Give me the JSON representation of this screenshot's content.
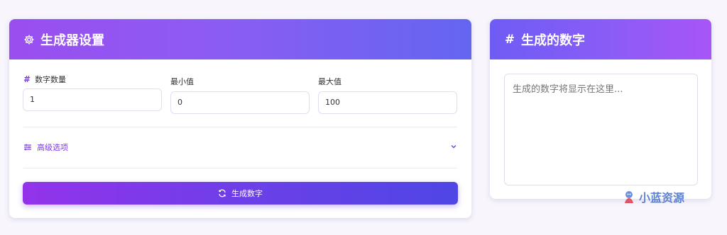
{
  "settings": {
    "title": "生成器设置",
    "fields": [
      {
        "label": "数字数量",
        "value": "1"
      },
      {
        "label": "最小值",
        "value": "0"
      },
      {
        "label": "最大值",
        "value": "100"
      }
    ],
    "advanced_label": "高级选项",
    "generate_label": "生成数字"
  },
  "output": {
    "title": "生成的数字",
    "placeholder": "生成的数字将显示在这里..."
  },
  "watermark": {
    "text": "小蓝资源"
  },
  "colors": {
    "accent": "#7c3aed",
    "gradient_start": "#9333ea",
    "gradient_end": "#4f46e5",
    "watermark": "#5b83d6"
  }
}
